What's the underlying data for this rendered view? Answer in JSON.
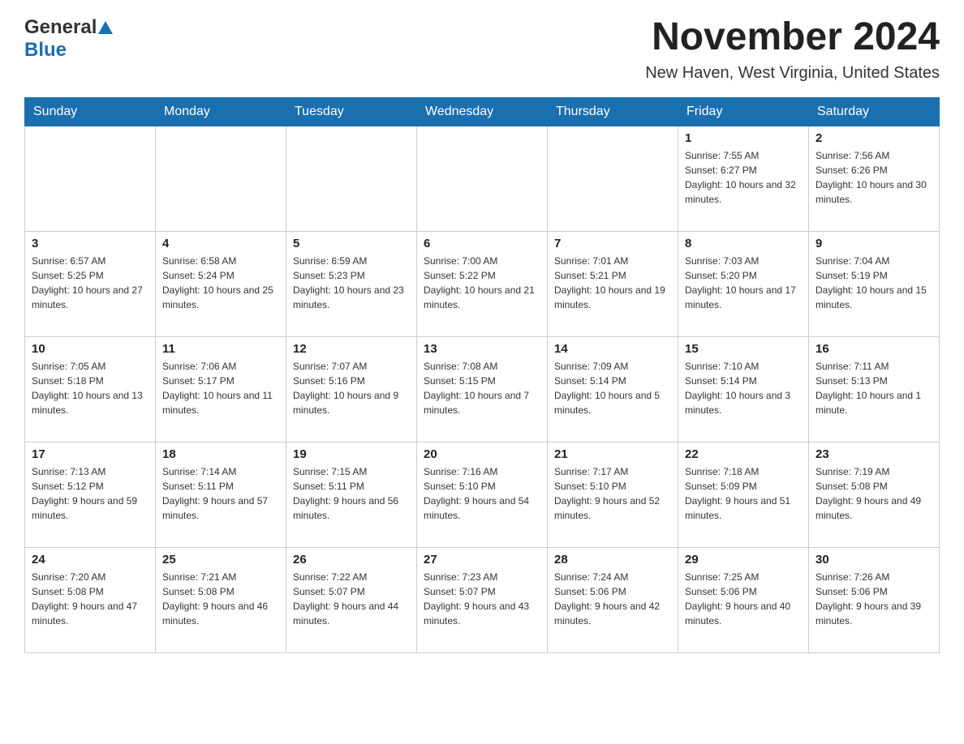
{
  "header": {
    "logo_general": "General",
    "logo_blue": "Blue",
    "month_title": "November 2024",
    "location": "New Haven, West Virginia, United States"
  },
  "calendar": {
    "days_of_week": [
      "Sunday",
      "Monday",
      "Tuesday",
      "Wednesday",
      "Thursday",
      "Friday",
      "Saturday"
    ],
    "rows": [
      [
        {
          "day": "",
          "sunrise": "",
          "sunset": "",
          "daylight": ""
        },
        {
          "day": "",
          "sunrise": "",
          "sunset": "",
          "daylight": ""
        },
        {
          "day": "",
          "sunrise": "",
          "sunset": "",
          "daylight": ""
        },
        {
          "day": "",
          "sunrise": "",
          "sunset": "",
          "daylight": ""
        },
        {
          "day": "",
          "sunrise": "",
          "sunset": "",
          "daylight": ""
        },
        {
          "day": "1",
          "sunrise": "Sunrise: 7:55 AM",
          "sunset": "Sunset: 6:27 PM",
          "daylight": "Daylight: 10 hours and 32 minutes."
        },
        {
          "day": "2",
          "sunrise": "Sunrise: 7:56 AM",
          "sunset": "Sunset: 6:26 PM",
          "daylight": "Daylight: 10 hours and 30 minutes."
        }
      ],
      [
        {
          "day": "3",
          "sunrise": "Sunrise: 6:57 AM",
          "sunset": "Sunset: 5:25 PM",
          "daylight": "Daylight: 10 hours and 27 minutes."
        },
        {
          "day": "4",
          "sunrise": "Sunrise: 6:58 AM",
          "sunset": "Sunset: 5:24 PM",
          "daylight": "Daylight: 10 hours and 25 minutes."
        },
        {
          "day": "5",
          "sunrise": "Sunrise: 6:59 AM",
          "sunset": "Sunset: 5:23 PM",
          "daylight": "Daylight: 10 hours and 23 minutes."
        },
        {
          "day": "6",
          "sunrise": "Sunrise: 7:00 AM",
          "sunset": "Sunset: 5:22 PM",
          "daylight": "Daylight: 10 hours and 21 minutes."
        },
        {
          "day": "7",
          "sunrise": "Sunrise: 7:01 AM",
          "sunset": "Sunset: 5:21 PM",
          "daylight": "Daylight: 10 hours and 19 minutes."
        },
        {
          "day": "8",
          "sunrise": "Sunrise: 7:03 AM",
          "sunset": "Sunset: 5:20 PM",
          "daylight": "Daylight: 10 hours and 17 minutes."
        },
        {
          "day": "9",
          "sunrise": "Sunrise: 7:04 AM",
          "sunset": "Sunset: 5:19 PM",
          "daylight": "Daylight: 10 hours and 15 minutes."
        }
      ],
      [
        {
          "day": "10",
          "sunrise": "Sunrise: 7:05 AM",
          "sunset": "Sunset: 5:18 PM",
          "daylight": "Daylight: 10 hours and 13 minutes."
        },
        {
          "day": "11",
          "sunrise": "Sunrise: 7:06 AM",
          "sunset": "Sunset: 5:17 PM",
          "daylight": "Daylight: 10 hours and 11 minutes."
        },
        {
          "day": "12",
          "sunrise": "Sunrise: 7:07 AM",
          "sunset": "Sunset: 5:16 PM",
          "daylight": "Daylight: 10 hours and 9 minutes."
        },
        {
          "day": "13",
          "sunrise": "Sunrise: 7:08 AM",
          "sunset": "Sunset: 5:15 PM",
          "daylight": "Daylight: 10 hours and 7 minutes."
        },
        {
          "day": "14",
          "sunrise": "Sunrise: 7:09 AM",
          "sunset": "Sunset: 5:14 PM",
          "daylight": "Daylight: 10 hours and 5 minutes."
        },
        {
          "day": "15",
          "sunrise": "Sunrise: 7:10 AM",
          "sunset": "Sunset: 5:14 PM",
          "daylight": "Daylight: 10 hours and 3 minutes."
        },
        {
          "day": "16",
          "sunrise": "Sunrise: 7:11 AM",
          "sunset": "Sunset: 5:13 PM",
          "daylight": "Daylight: 10 hours and 1 minute."
        }
      ],
      [
        {
          "day": "17",
          "sunrise": "Sunrise: 7:13 AM",
          "sunset": "Sunset: 5:12 PM",
          "daylight": "Daylight: 9 hours and 59 minutes."
        },
        {
          "day": "18",
          "sunrise": "Sunrise: 7:14 AM",
          "sunset": "Sunset: 5:11 PM",
          "daylight": "Daylight: 9 hours and 57 minutes."
        },
        {
          "day": "19",
          "sunrise": "Sunrise: 7:15 AM",
          "sunset": "Sunset: 5:11 PM",
          "daylight": "Daylight: 9 hours and 56 minutes."
        },
        {
          "day": "20",
          "sunrise": "Sunrise: 7:16 AM",
          "sunset": "Sunset: 5:10 PM",
          "daylight": "Daylight: 9 hours and 54 minutes."
        },
        {
          "day": "21",
          "sunrise": "Sunrise: 7:17 AM",
          "sunset": "Sunset: 5:10 PM",
          "daylight": "Daylight: 9 hours and 52 minutes."
        },
        {
          "day": "22",
          "sunrise": "Sunrise: 7:18 AM",
          "sunset": "Sunset: 5:09 PM",
          "daylight": "Daylight: 9 hours and 51 minutes."
        },
        {
          "day": "23",
          "sunrise": "Sunrise: 7:19 AM",
          "sunset": "Sunset: 5:08 PM",
          "daylight": "Daylight: 9 hours and 49 minutes."
        }
      ],
      [
        {
          "day": "24",
          "sunrise": "Sunrise: 7:20 AM",
          "sunset": "Sunset: 5:08 PM",
          "daylight": "Daylight: 9 hours and 47 minutes."
        },
        {
          "day": "25",
          "sunrise": "Sunrise: 7:21 AM",
          "sunset": "Sunset: 5:08 PM",
          "daylight": "Daylight: 9 hours and 46 minutes."
        },
        {
          "day": "26",
          "sunrise": "Sunrise: 7:22 AM",
          "sunset": "Sunset: 5:07 PM",
          "daylight": "Daylight: 9 hours and 44 minutes."
        },
        {
          "day": "27",
          "sunrise": "Sunrise: 7:23 AM",
          "sunset": "Sunset: 5:07 PM",
          "daylight": "Daylight: 9 hours and 43 minutes."
        },
        {
          "day": "28",
          "sunrise": "Sunrise: 7:24 AM",
          "sunset": "Sunset: 5:06 PM",
          "daylight": "Daylight: 9 hours and 42 minutes."
        },
        {
          "day": "29",
          "sunrise": "Sunrise: 7:25 AM",
          "sunset": "Sunset: 5:06 PM",
          "daylight": "Daylight: 9 hours and 40 minutes."
        },
        {
          "day": "30",
          "sunrise": "Sunrise: 7:26 AM",
          "sunset": "Sunset: 5:06 PM",
          "daylight": "Daylight: 9 hours and 39 minutes."
        }
      ]
    ]
  }
}
